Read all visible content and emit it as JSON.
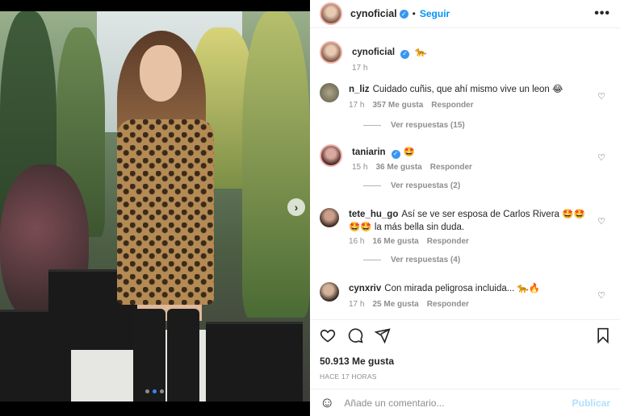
{
  "post": {
    "author": "cynoficial",
    "follow_label": "Seguir",
    "separator": "•",
    "more_label": "•••",
    "caption_emoji": "🐆",
    "caption_time": "17 h",
    "verified_mark": "✓"
  },
  "comments": [
    {
      "user": "n_liz",
      "text": "Cuidado cuñis, que ahí mismo vive un leon 😂",
      "time": "17 h",
      "likes": "357 Me gusta",
      "reply": "Responder",
      "replies": "Ver respuestas (15)",
      "verified": false
    },
    {
      "user": "taniarin",
      "text": "🤩",
      "time": "15 h",
      "likes": "36 Me gusta",
      "reply": "Responder",
      "replies": "Ver respuestas (2)",
      "verified": true
    },
    {
      "user": "tete_hu_go",
      "text": "Así se ve ser esposa de Carlos Rivera 🤩🤩🤩🤩 la más bella sin duda.",
      "time": "16 h",
      "likes": "16 Me gusta",
      "reply": "Responder",
      "replies": "Ver respuestas (4)",
      "verified": false
    },
    {
      "user": "cynxriv",
      "text": "Con mirada peligrosa incluida... 🐆🔥",
      "time": "17 h",
      "likes": "25 Me gusta",
      "reply": "Responder",
      "replies": "",
      "verified": false
    }
  ],
  "actions": {
    "like_icon": "heart-icon",
    "comment_icon": "comment-icon",
    "share_icon": "share-icon",
    "save_icon": "bookmark-icon"
  },
  "likes_count": "50.913 Me gusta",
  "posted_ago": "HACE 17 HORAS",
  "add_comment": {
    "placeholder": "Añade un comentario...",
    "publish_label": "Publicar"
  },
  "colors": {
    "accent": "#0095f6",
    "verified": "#3897f0",
    "carousel_dot_active": "#3b82f6"
  }
}
